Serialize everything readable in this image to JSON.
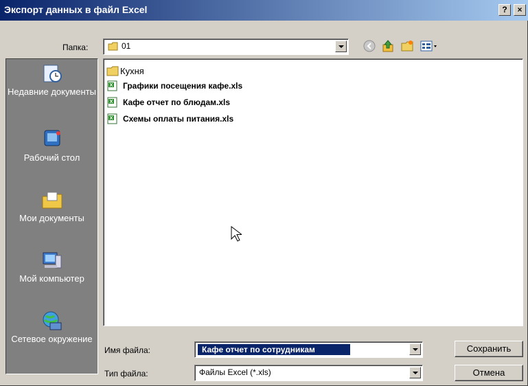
{
  "window": {
    "title": "Экспорт данных в файл Excel",
    "help_label": "?",
    "close_label": "×"
  },
  "lookin": {
    "label": "Папка:",
    "value": "01"
  },
  "places": [
    {
      "label": "Недавние документы",
      "icon": "recent-documents-icon"
    },
    {
      "label": "Рабочий стол",
      "icon": "desktop-icon"
    },
    {
      "label": "Мои документы",
      "icon": "my-documents-icon"
    },
    {
      "label": "Мой компьютер",
      "icon": "my-computer-icon"
    },
    {
      "label": "Сетевое окружение",
      "icon": "network-places-icon"
    }
  ],
  "files": [
    {
      "name": "Кухня",
      "type": "folder"
    },
    {
      "name": "Графики посещения кафе.xls",
      "type": "excel"
    },
    {
      "name": "Кафе отчет по блюдам.xls",
      "type": "excel"
    },
    {
      "name": "Схемы оплаты питания.xls",
      "type": "excel"
    }
  ],
  "filename": {
    "label": "Имя файла:",
    "value": "Кафе отчет по сотрудникам"
  },
  "filetype": {
    "label": "Тип файла:",
    "value": "Файлы Excel (*.xls)"
  },
  "buttons": {
    "save": "Сохранить",
    "cancel": "Отмена"
  },
  "colors": {
    "title_start": "#0a246a",
    "title_end": "#a6caf0",
    "selection": "#0a246a",
    "places_bg": "#808080",
    "dialog_bg": "#d4d0c8"
  }
}
